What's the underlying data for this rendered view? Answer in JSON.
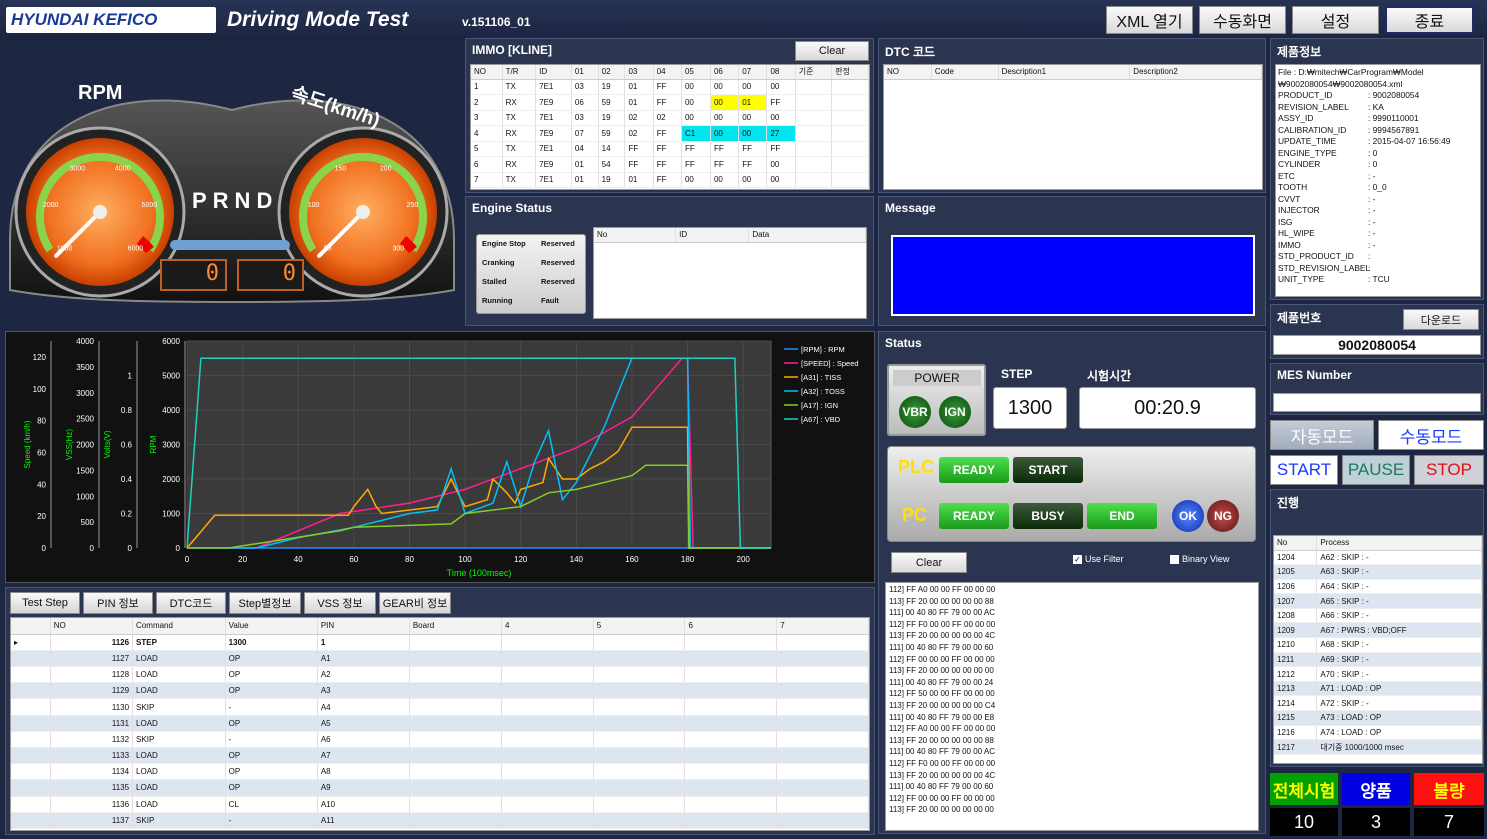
{
  "header": {
    "logo": "HYUNDAI KEFICO",
    "title": "Driving Mode Test",
    "version": "v.151106_01",
    "buttons": [
      "XML 열기",
      "수동화면",
      "설정",
      "종료"
    ]
  },
  "gauges": {
    "rpm_label": "RPM",
    "speed_label": "속도(km/h)",
    "gear": "PRND",
    "rpm_ticks": [
      "1000",
      "2000",
      "3000",
      "4000",
      "5000",
      "6000"
    ],
    "speed_ticks": [
      "50",
      "100",
      "150",
      "200",
      "250",
      "300"
    ],
    "rpm_value": "0",
    "speed_value": "0",
    "rpm_needle_fraction": 0.0,
    "speed_needle_fraction": 0.0
  },
  "immo": {
    "title": "IMMO [KLINE]",
    "clear": "Clear",
    "headers": [
      "NO",
      "T/R",
      "ID",
      "01",
      "02",
      "03",
      "04",
      "05",
      "06",
      "07",
      "08",
      "기준",
      "판정"
    ],
    "rows": [
      [
        "1",
        "TX",
        "7E1",
        "03",
        "19",
        "01",
        "FF",
        "00",
        "00",
        "00",
        "00",
        "",
        ""
      ],
      [
        "2",
        "RX",
        "7E9",
        "06",
        "59",
        "01",
        "FF",
        "00",
        "00",
        "01",
        "FF",
        "",
        ""
      ],
      [
        "3",
        "TX",
        "7E1",
        "03",
        "19",
        "02",
        "02",
        "00",
        "00",
        "00",
        "00",
        "",
        ""
      ],
      [
        "4",
        "RX",
        "7E9",
        "07",
        "59",
        "02",
        "FF",
        "C1",
        "00",
        "00",
        "27",
        "",
        ""
      ],
      [
        "5",
        "TX",
        "7E1",
        "04",
        "14",
        "FF",
        "FF",
        "FF",
        "FF",
        "FF",
        "FF",
        "",
        ""
      ],
      [
        "6",
        "RX",
        "7E9",
        "01",
        "54",
        "FF",
        "FF",
        "FF",
        "FF",
        "FF",
        "00",
        "",
        ""
      ],
      [
        "7",
        "TX",
        "7E1",
        "01",
        "19",
        "01",
        "FF",
        "00",
        "00",
        "00",
        "00",
        "",
        ""
      ]
    ]
  },
  "dtc": {
    "title": "DTC 코드",
    "headers": [
      "NO",
      "Code",
      "Description1",
      "Description2"
    ]
  },
  "product_info": {
    "title": "제품정보",
    "file_line1": "File : D:₩mitech₩CarProgram₩Model",
    "file_line2": "₩9002080054₩9002080054.xml",
    "fields": [
      [
        "PRODUCT_ID",
        ": 9002080054"
      ],
      [
        "REVISION_LABEL",
        ": KA"
      ],
      [
        "ASSY_ID",
        ": 9990110001"
      ],
      [
        "CALIBRATION_ID",
        ": 9994567891"
      ],
      [
        "UPDATE_TIME",
        ": 2015-04-07 16:56:49"
      ],
      [
        "ENGINE_TYPE",
        ": 0"
      ],
      [
        "CYLINDER",
        ": 0"
      ],
      [
        "ETC",
        ": -"
      ],
      [
        "TOOTH",
        ": 0_0"
      ],
      [
        "CVVT",
        ": -"
      ],
      [
        "INJECTOR",
        ": -"
      ],
      [
        "ISG",
        ": -"
      ],
      [
        "HL_WIPE",
        ": -"
      ],
      [
        "IMMO",
        ": -"
      ],
      [
        "STD_PRODUCT_ID",
        ":"
      ],
      [
        "STD_REVISION_LABEL",
        ":"
      ],
      [
        "UNIT_TYPE",
        ": TCU"
      ]
    ]
  },
  "engine_status": {
    "title": "Engine Status",
    "states": [
      [
        "Engine Stop",
        "Reserved"
      ],
      [
        "Cranking",
        "Reserved"
      ],
      [
        "Stalled",
        "Reserved"
      ],
      [
        "Running",
        "Fault"
      ]
    ],
    "headers": [
      "No",
      "ID",
      "Data"
    ]
  },
  "message": {
    "title": "Message"
  },
  "serial": {
    "title": "제품번호",
    "download": "다운로드",
    "value": "9002080054"
  },
  "mes": {
    "title": "MES Number"
  },
  "modes": {
    "auto": "자동모드",
    "manual": "수동모드"
  },
  "controls": {
    "start": "START",
    "pause": "PAUSE",
    "stop": "STOP"
  },
  "status": {
    "title": "Status",
    "power": "POWER",
    "vbr": "VBR",
    "ign": "IGN",
    "step_label": "STEP",
    "step_value": "1300",
    "time_label": "시험시간",
    "time_value": "00:20.9",
    "plc": "PLC",
    "pc": "PC",
    "plc_ready": "READY",
    "plc_start": "START",
    "pc_ready": "READY",
    "pc_busy": "BUSY",
    "pc_end": "END",
    "ok": "OK",
    "ng": "NG",
    "clear": "Clear",
    "use_filter": "Use Filter",
    "binary_view": "Binary View"
  },
  "log": [
    "112] FF A0 00 00 FF 00 00 00",
    "113] FF 20 00 00 00 00 00 88",
    "111] 00 40 80 FF 79 00 00 AC",
    "112] FF F0 00 00 FF 00 00 00",
    "113] FF 20 00 00 00 00 00 4C",
    "111] 00 40 80 FF 79 00 00 60",
    "112] FF 00 00 00 FF 00 00 00",
    "113] FF 20 00 00 00 00 00 00",
    "111] 00 40 80 FF 79 00 00 24",
    "112] FF 50 00 00 FF 00 00 00",
    "113] FF 20 00 00 00 00 00 C4",
    "111] 00 40 80 FF 79 00 00 E8",
    "112] FF A0 00 00 FF 00 00 00",
    "113] FF 20 00 00 00 00 00 88",
    "111] 00 40 80 FF 79 00 00 AC",
    "112] FF F0 00 00 FF 00 00 00",
    "113] FF 20 00 00 00 00 00 4C",
    "111] 00 40 80 FF 79 00 00 60",
    "112] FF 00 00 00 FF 00 00 00",
    "113] FF 20 00 00 00 00 00 00"
  ],
  "progress": {
    "title": "진행",
    "headers": [
      "No",
      "Process"
    ],
    "rows": [
      [
        "1204",
        "A62 : SKIP : -"
      ],
      [
        "1205",
        "A63 : SKIP : -"
      ],
      [
        "1206",
        "A64 : SKIP : -"
      ],
      [
        "1207",
        "A65 : SKIP : -"
      ],
      [
        "1208",
        "A66 : SKIP : -"
      ],
      [
        "1209",
        "A67 : PWRS : VBD;OFF"
      ],
      [
        "1210",
        "A68 : SKIP : -"
      ],
      [
        "1211",
        "A69 : SKIP : -"
      ],
      [
        "1212",
        "A70 : SKIP : -"
      ],
      [
        "1213",
        "A71 : LOAD : OP"
      ],
      [
        "1214",
        "A72 : SKIP : -"
      ],
      [
        "1215",
        "A73 : LOAD : OP"
      ],
      [
        "1216",
        "A74 : LOAD : OP"
      ],
      [
        "1217",
        "대기중 1000/1000 msec"
      ]
    ]
  },
  "counts": {
    "total_label": "전체시험",
    "good_label": "양품",
    "bad_label": "불량",
    "total": "10",
    "good": "3",
    "bad": "7"
  },
  "tabs": [
    "Test Step",
    "PIN 정보",
    "DTC코드",
    "Step별정보",
    "VSS 정보",
    "GEAR비 정보"
  ],
  "steps": {
    "headers": [
      "NO",
      "Command",
      "Value",
      "PIN",
      "Board",
      "4",
      "5",
      "6",
      "7"
    ],
    "rows": [
      [
        "1126",
        "STEP",
        "1300",
        "1"
      ],
      [
        "1127",
        "LOAD",
        "OP",
        "A1"
      ],
      [
        "1128",
        "LOAD",
        "OP",
        "A2"
      ],
      [
        "1129",
        "LOAD",
        "OP",
        "A3"
      ],
      [
        "1130",
        "SKIP",
        "-",
        "A4"
      ],
      [
        "1131",
        "LOAD",
        "OP",
        "A5"
      ],
      [
        "1132",
        "SKIP",
        "-",
        "A6"
      ],
      [
        "1133",
        "LOAD",
        "OP",
        "A7"
      ],
      [
        "1134",
        "LOAD",
        "OP",
        "A8"
      ],
      [
        "1135",
        "LOAD",
        "OP",
        "A9"
      ],
      [
        "1136",
        "LOAD",
        "CL",
        "A10"
      ],
      [
        "1137",
        "SKIP",
        "-",
        "A11"
      ]
    ]
  },
  "chart_data": {
    "type": "line",
    "xlabel": "Time (100msec)",
    "xlim": [
      0,
      210
    ],
    "x_ticks": [
      0,
      20,
      40,
      60,
      80,
      100,
      120,
      140,
      160,
      180,
      200
    ],
    "axes": [
      {
        "label": "Speed (km/h)",
        "ticks": [
          0,
          20,
          40,
          60,
          80,
          100,
          120
        ],
        "range": [
          0,
          130
        ],
        "color": "#00ff00"
      },
      {
        "label": "VSS(Hz)",
        "ticks": [
          0,
          500,
          1000,
          1500,
          2000,
          2500,
          3000,
          3500,
          4000
        ],
        "range": [
          0,
          4000
        ],
        "color": "#00ff00"
      },
      {
        "label": "Volts(V)",
        "ticks": [
          0,
          0.2,
          0.4,
          0.6,
          0.8,
          1
        ],
        "range": [
          0,
          1.2
        ],
        "color": "#00ff00"
      },
      {
        "label": "RPM",
        "ticks": [
          0,
          1000,
          2000,
          3000,
          4000,
          5000,
          6000
        ],
        "range": [
          0,
          6000
        ],
        "color": "#00ff00"
      }
    ],
    "series": [
      {
        "name": "[RPM] : RPM",
        "color": "#1e90ff",
        "x": [
          0,
          9,
          9.5,
          10,
          200
        ],
        "y": [
          0,
          0,
          0,
          0,
          0
        ]
      },
      {
        "name": "[SPEED] : Speed",
        "color": "#ff1f8f",
        "x": [
          0,
          25,
          55,
          80,
          100,
          120,
          140,
          160,
          178,
          180,
          182,
          210
        ],
        "y": [
          0,
          0,
          1000,
          1300,
          1700,
          2300,
          2900,
          3800,
          5500,
          5500,
          0,
          0
        ]
      },
      {
        "name": "[A31] : TISS",
        "color": "#ffaa00",
        "x": [
          0,
          10,
          58,
          60,
          65,
          68,
          70,
          90,
          95,
          98,
          100,
          108,
          110,
          115,
          118,
          120,
          128,
          130,
          135,
          140,
          145,
          150,
          155,
          160,
          165,
          180,
          180.5,
          210
        ],
        "y": [
          0,
          950,
          950,
          1200,
          1700,
          1200,
          1000,
          1200,
          2000,
          1500,
          1200,
          1400,
          2000,
          1600,
          1300,
          1700,
          1900,
          2600,
          2000,
          2000,
          2300,
          2500,
          2800,
          3500,
          3500,
          3500,
          0,
          0
        ]
      },
      {
        "name": "[A32] : TOSS",
        "color": "#00bfff",
        "x": [
          0,
          25,
          40,
          60,
          80,
          90,
          95,
          100,
          110,
          115,
          120,
          125,
          130,
          135,
          140,
          150,
          160,
          165,
          180,
          181,
          210
        ],
        "y": [
          0,
          0,
          300,
          600,
          1000,
          1100,
          2300,
          1000,
          1300,
          2500,
          1200,
          2500,
          3400,
          1400,
          1900,
          3500,
          5500,
          5500,
          5500,
          0,
          0
        ]
      },
      {
        "name": "[A17] : IGN",
        "color": "#88cc22",
        "x": [
          0,
          15,
          55,
          60,
          95,
          100,
          120,
          130,
          140,
          160,
          165,
          180,
          180.5,
          210
        ],
        "y": [
          0,
          0,
          500,
          600,
          700,
          1000,
          1200,
          1600,
          1700,
          2100,
          2400,
          2400,
          0,
          0
        ]
      },
      {
        "name": "[A67] : VBD",
        "color": "#20d0c0",
        "x": [
          0,
          5,
          6,
          178,
          180,
          182,
          197,
          199,
          210
        ],
        "y": [
          0,
          5500,
          5500,
          5500,
          5500,
          5500,
          5500,
          0,
          0
        ]
      }
    ]
  },
  "colors": {
    "bg": "#1e2742",
    "accent_blue": "#0000ff",
    "good": "#0000e0",
    "bad": "#ff1010",
    "total": "#00a000"
  }
}
